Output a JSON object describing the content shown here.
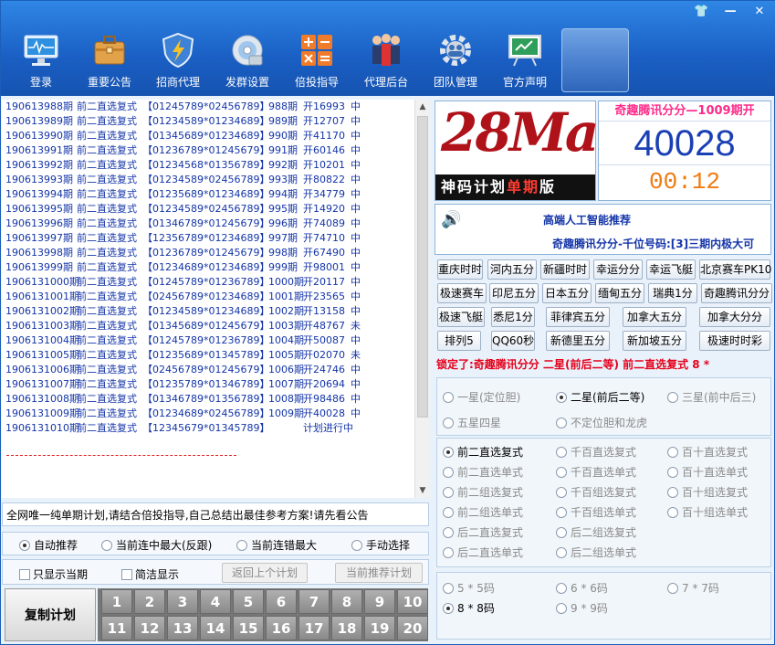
{
  "toolbar": {
    "items": [
      {
        "label": "登录",
        "icon": "monitor-icon"
      },
      {
        "label": "重要公告",
        "icon": "briefcase-icon"
      },
      {
        "label": "招商代理",
        "icon": "shield-icon"
      },
      {
        "label": "发群设置",
        "icon": "disc-icon"
      },
      {
        "label": "倍投指导",
        "icon": "calculator-icon"
      },
      {
        "label": "代理后台",
        "icon": "people-icon"
      },
      {
        "label": "团队管理",
        "icon": "gear-people-icon"
      },
      {
        "label": "官方声明",
        "icon": "board-icon"
      }
    ],
    "window_controls": [
      "shirt-icon",
      "minimize-icon",
      "close-icon"
    ],
    "shirt": "👕",
    "minimize": "—",
    "close": "✕"
  },
  "plan_rows": [
    {
      "id": "190613988期",
      "type": "前二直选复式",
      "codes": "【01245789*02456789】",
      "issue": "988期",
      "open": "开16993",
      "result": "中"
    },
    {
      "id": "190613989期",
      "type": "前二直选复式",
      "codes": "【01234589*01234689】",
      "issue": "989期",
      "open": "开12707",
      "result": "中"
    },
    {
      "id": "190613990期",
      "type": "前二直选复式",
      "codes": "【01345689*01234689】",
      "issue": "990期",
      "open": "开41170",
      "result": "中"
    },
    {
      "id": "190613991期",
      "type": "前二直选复式",
      "codes": "【01236789*01245679】",
      "issue": "991期",
      "open": "开60146",
      "result": "中"
    },
    {
      "id": "190613992期",
      "type": "前二直选复式",
      "codes": "【01234568*01356789】",
      "issue": "992期",
      "open": "开10201",
      "result": "中"
    },
    {
      "id": "190613993期",
      "type": "前二直选复式",
      "codes": "【01234589*02456789】",
      "issue": "993期",
      "open": "开80822",
      "result": "中"
    },
    {
      "id": "190613994期",
      "type": "前二直选复式",
      "codes": "【01235689*01234689】",
      "issue": "994期",
      "open": "开34779",
      "result": "中"
    },
    {
      "id": "190613995期",
      "type": "前二直选复式",
      "codes": "【01234589*02456789】",
      "issue": "995期",
      "open": "开14920",
      "result": "中"
    },
    {
      "id": "190613996期",
      "type": "前二直选复式",
      "codes": "【01346789*01245679】",
      "issue": "996期",
      "open": "开74089",
      "result": "中"
    },
    {
      "id": "190613997期",
      "type": "前二直选复式",
      "codes": "【12356789*01234689】",
      "issue": "997期",
      "open": "开74710",
      "result": "中"
    },
    {
      "id": "190613998期",
      "type": "前二直选复式",
      "codes": "【01236789*01245679】",
      "issue": "998期",
      "open": "开67490",
      "result": "中"
    },
    {
      "id": "190613999期",
      "type": "前二直选复式",
      "codes": "【01234689*01234689】",
      "issue": "999期",
      "open": "开98001",
      "result": "中"
    },
    {
      "id": "1906131000期",
      "type": "前二直选复式",
      "codes": "【01245789*01236789】",
      "issue": "1000期",
      "open": "开20117",
      "result": "中"
    },
    {
      "id": "1906131001期",
      "type": "前二直选复式",
      "codes": "【02456789*01234689】",
      "issue": "1001期",
      "open": "开23565",
      "result": "中"
    },
    {
      "id": "1906131002期",
      "type": "前二直选复式",
      "codes": "【01234589*01234689】",
      "issue": "1002期",
      "open": "开13158",
      "result": "中"
    },
    {
      "id": "1906131003期",
      "type": "前二直选复式",
      "codes": "【01345689*01245679】",
      "issue": "1003期",
      "open": "开48767",
      "result": "未"
    },
    {
      "id": "1906131004期",
      "type": "前二直选复式",
      "codes": "【01245789*01236789】",
      "issue": "1004期",
      "open": "开50087",
      "result": "中"
    },
    {
      "id": "1906131005期",
      "type": "前二直选复式",
      "codes": "【01235689*01345789】",
      "issue": "1005期",
      "open": "开02070",
      "result": "未"
    },
    {
      "id": "1906131006期",
      "type": "前二直选复式",
      "codes": "【02456789*01245679】",
      "issue": "1006期",
      "open": "开24746",
      "result": "中"
    },
    {
      "id": "1906131007期",
      "type": "前二直选复式",
      "codes": "【01235789*01346789】",
      "issue": "1007期",
      "open": "开20694",
      "result": "中"
    },
    {
      "id": "1906131008期",
      "type": "前二直选复式",
      "codes": "【01346789*01356789】",
      "issue": "1008期",
      "open": "开98486",
      "result": "中"
    },
    {
      "id": "1906131009期",
      "type": "前二直选复式",
      "codes": "【01234689*02456789】",
      "issue": "1009期",
      "open": "开40028",
      "result": "中"
    },
    {
      "id": "1906131010期",
      "type": "前二直选复式",
      "codes": "【12345679*01345789】",
      "issue": "",
      "open": "计划进行中",
      "result": ""
    }
  ],
  "scroll": {
    "up": "▲",
    "down": "▼"
  },
  "notice": "全网唯一纯单期计划,请结合倍投指导,自己总结出最佳参考方案!请先看公告",
  "modes": [
    {
      "label": "自动推荐",
      "selected": true
    },
    {
      "label": "当前连中最大(反跟)",
      "selected": false
    },
    {
      "label": "当前连错最大",
      "selected": false
    },
    {
      "label": "手动选择",
      "selected": false
    }
  ],
  "options": {
    "only_current": "只显示当期",
    "simple": "简洁显示",
    "prev_plan": "返回上个计划",
    "current_plan": "当前推荐计划"
  },
  "copy_plan": "复制计划",
  "numbers": [
    "1",
    "2",
    "3",
    "4",
    "5",
    "6",
    "7",
    "8",
    "9",
    "10",
    "11",
    "12",
    "13",
    "14",
    "15",
    "16",
    "17",
    "18",
    "19",
    "20"
  ],
  "logo": {
    "brand": "28Ma",
    "band_left": "神码计划",
    "band_highlight": "单期",
    "band_right": "版"
  },
  "counter": {
    "title": "奇趣腾讯分分—1009期开",
    "number": "40028",
    "timer": "00:12"
  },
  "recommend": {
    "speaker_icon": "🔊",
    "title": "高端人工智能推荐",
    "text": "奇趣腾讯分分-千位号码:[3]三期内极大可"
  },
  "lotteries": [
    "重庆时时",
    "河内五分",
    "新疆时时",
    "幸运分分",
    "幸运飞艇",
    "北京赛车PK10",
    "极速赛车",
    "印尼五分",
    "日本五分",
    "缅甸五分",
    "瑞典1分",
    "奇趣腾讯分分",
    "极速飞艇",
    "悉尼1分",
    "菲律宾五分",
    "加拿大五分",
    "加拿大分分",
    "排列5",
    "QQ60秒",
    "新德里五分",
    "新加坡五分",
    "极速时时彩"
  ],
  "lock_text": "锁定了:奇趣腾讯分分 二星(前后二等) 前二直选复式 8 *",
  "group1": [
    {
      "label": "一星(定位胆)",
      "selected": false
    },
    {
      "label": "二星(前后二等)",
      "selected": true
    },
    {
      "label": "三星(前中后三)",
      "selected": false
    },
    {
      "label": "五星四星",
      "selected": false
    },
    {
      "label": "不定位胆和龙虎",
      "selected": false
    }
  ],
  "group2": [
    {
      "label": "前二直选复式",
      "selected": true
    },
    {
      "label": "千百直选复式",
      "selected": false
    },
    {
      "label": "百十直选复式",
      "selected": false
    },
    {
      "label": "前二直选单式",
      "selected": false
    },
    {
      "label": "千百直选单式",
      "selected": false
    },
    {
      "label": "百十直选单式",
      "selected": false
    },
    {
      "label": "前二组选复式",
      "selected": false
    },
    {
      "label": "千百组选复式",
      "selected": false
    },
    {
      "label": "百十组选复式",
      "selected": false
    },
    {
      "label": "前二组选单式",
      "selected": false
    },
    {
      "label": "千百组选单式",
      "selected": false
    },
    {
      "label": "百十组选单式",
      "selected": false
    },
    {
      "label": "后二直选复式",
      "selected": false
    },
    {
      "label": "后二组选复式",
      "selected": false
    },
    {
      "label": "后二直选单式",
      "selected": false
    },
    {
      "label": "后二组选单式",
      "selected": false
    }
  ],
  "group3": [
    {
      "label": "5 * 5码",
      "selected": false
    },
    {
      "label": "6 * 6码",
      "selected": false
    },
    {
      "label": "7 * 7码",
      "selected": false
    },
    {
      "label": "8 * 8码",
      "selected": true
    },
    {
      "label": "9 * 9码",
      "selected": false
    }
  ],
  "colors": {
    "accent": "#1a5fc4",
    "red": "#e6001a",
    "blue_text": "#1435a8",
    "pink": "#ff2a8a",
    "orange": "#f07a10"
  }
}
